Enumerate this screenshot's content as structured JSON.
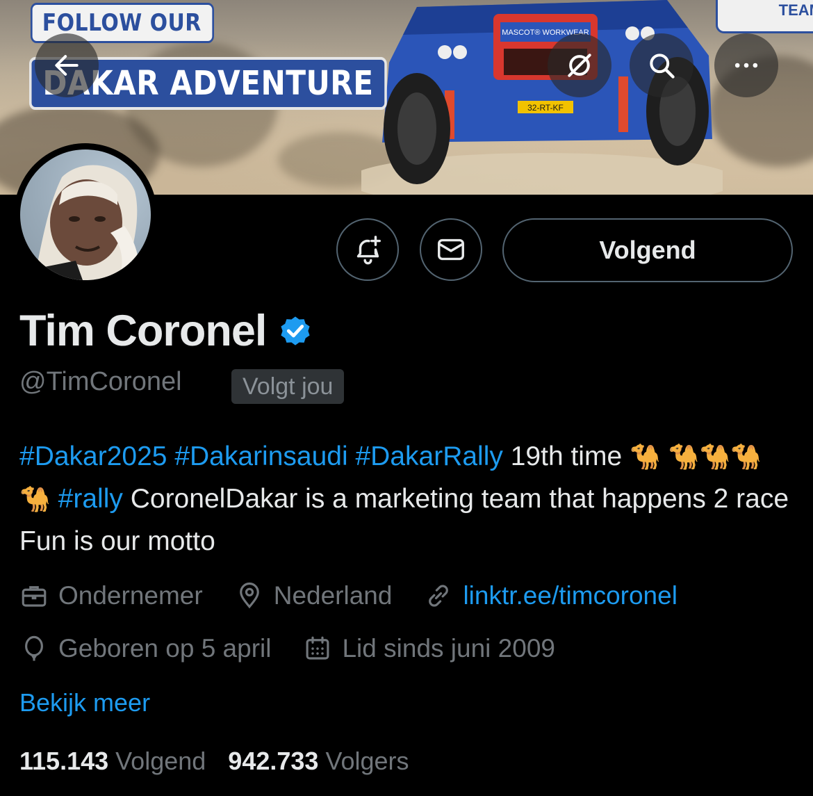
{
  "banner": {
    "promo_line1": "FOLLOW OUR",
    "promo_line2": "DAKAR ADVENTURE",
    "team_tag": "TEAM",
    "car_plate": "32-RT-KF",
    "car_sponsor": "MASCOT® WORKWEAR"
  },
  "nav": {
    "back_icon": "arrow-left-icon",
    "grok_icon": "grok-slash-icon",
    "search_icon": "search-icon",
    "more_icon": "more-horizontal-icon"
  },
  "profile_actions": {
    "notify_icon": "bell-plus-icon",
    "message_icon": "envelope-icon",
    "follow_state_label": "Volgend"
  },
  "profile": {
    "display_name": "Tim Coronel",
    "handle": "@TimCoronel",
    "follows_you_label": "Volgt jou",
    "verified_color": "#1d9bf0",
    "bio": {
      "hashtag_1": "#Dakar2025",
      "hashtag_2": "#Dakarinsaudi",
      "hashtag_3": "#DakarRally",
      "text_1": "19th time",
      "camels_a": "🐪",
      "camels_b": "🐪🐪🐪🐪",
      "hashtag_4": "#rally",
      "text_2": "CoronelDakar is a marketing team that happens 2 race Fun is our motto"
    },
    "meta": {
      "profession": "Ondernemer",
      "location": "Nederland",
      "website": "linktr.ee/timcoronel",
      "birthday": "Geboren op 5 april",
      "joined": "Lid sinds juni 2009"
    },
    "see_more_label": "Bekijk meer",
    "stats": {
      "following_count": "115.143",
      "following_label": "Volgend",
      "followers_count": "942.733",
      "followers_label": "Volgers"
    }
  },
  "colors": {
    "background": "#000000",
    "link": "#1d9bf0",
    "muted": "#71767b",
    "border": "#536471",
    "promo_blue": "#2c4f9e"
  }
}
